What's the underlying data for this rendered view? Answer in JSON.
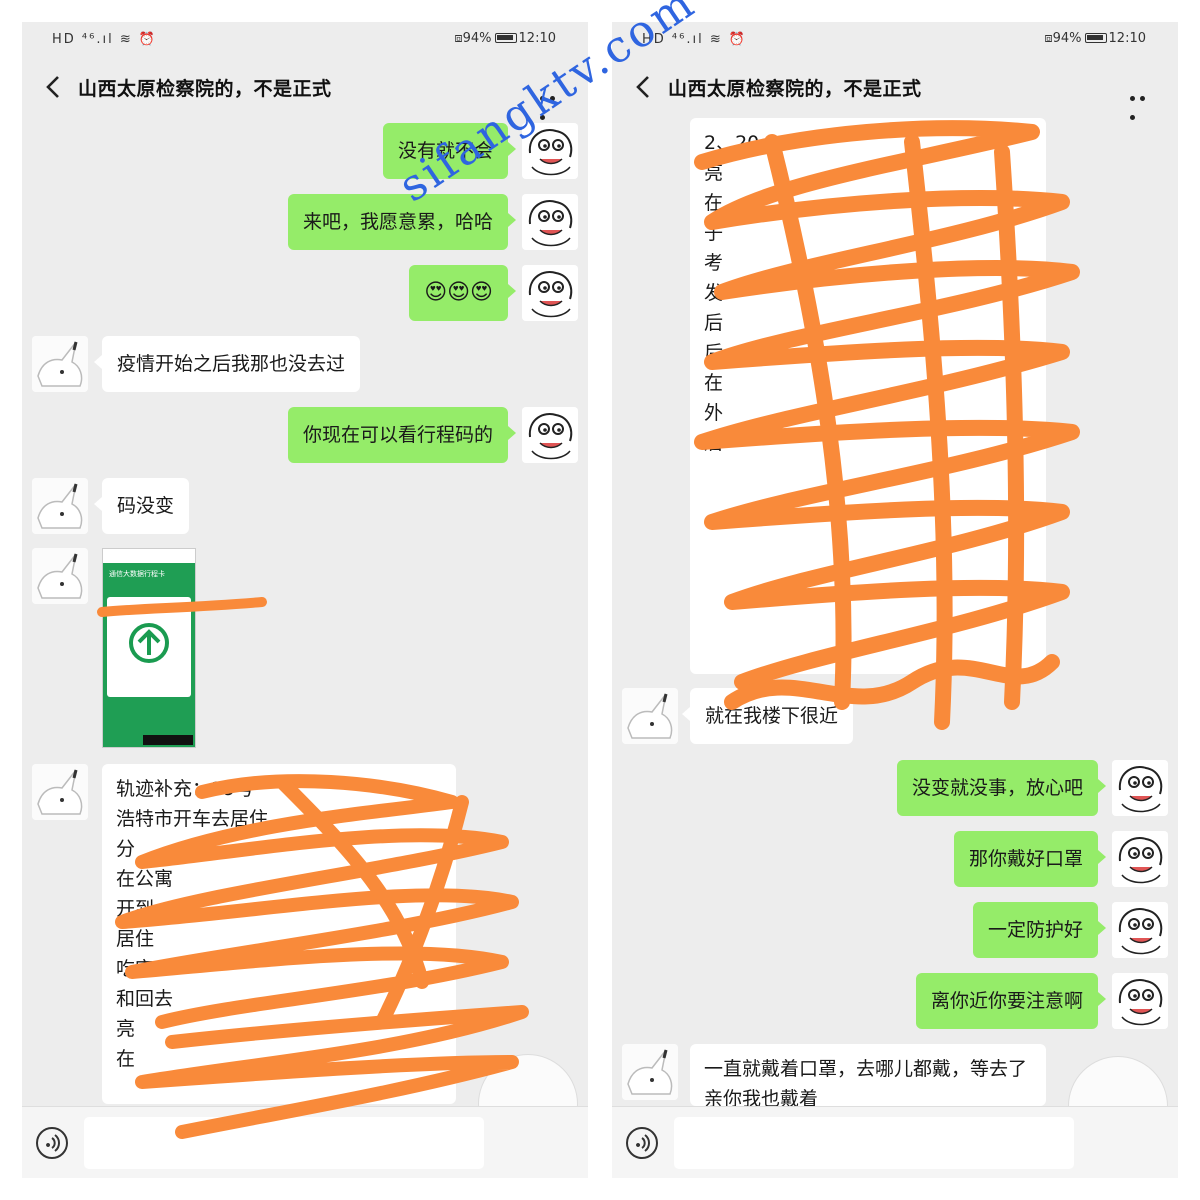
{
  "status": {
    "signal": "HD ⁴⁶.ıl ≋ ⏰",
    "battery": "94%",
    "time": "12:10",
    "vibrate": "▯▯"
  },
  "chat": {
    "title": "山西太原检察院的，不是正式"
  },
  "left": {
    "messages": {
      "m1": "没有就不会",
      "m2": "来吧，我愿意累，哈哈",
      "m3": "😍😍😍",
      "m4": "疫情开始之后我那也没去过",
      "m5": "你现在可以看行程码的",
      "m6": "码没变",
      "m8": "轨迹补充：19号\n浩特市开车去居住\n分\n在公寓\n开到\n居住\n吃完\n和回去\n亮\n在",
      "card_header": "通信大数据行程卡"
    }
  },
  "right": {
    "messages": {
      "r1": "2、20\n亮\n在\n子\n考\n发\n后\n后\n在\n外\n后",
      "r2": "就在我楼下很近",
      "r3": "没变就没事，放心吧",
      "r4": "那你戴好口罩",
      "r5": "一定防护好",
      "r6": "离你近你要注意啊",
      "r7": "一直就戴着口罩，去哪儿都戴，等去了亲你我也戴着"
    }
  },
  "watermark": "sifangktv.com",
  "colors": {
    "bubble_green": "#95ec69",
    "scribble_orange": "#f98a3a",
    "watermark_blue": "#2f65e0",
    "qr_green": "#1a9b50"
  },
  "icons": {
    "back": "chevron-left-icon",
    "more": "more-dots-icon",
    "voice": "voice-icon"
  }
}
